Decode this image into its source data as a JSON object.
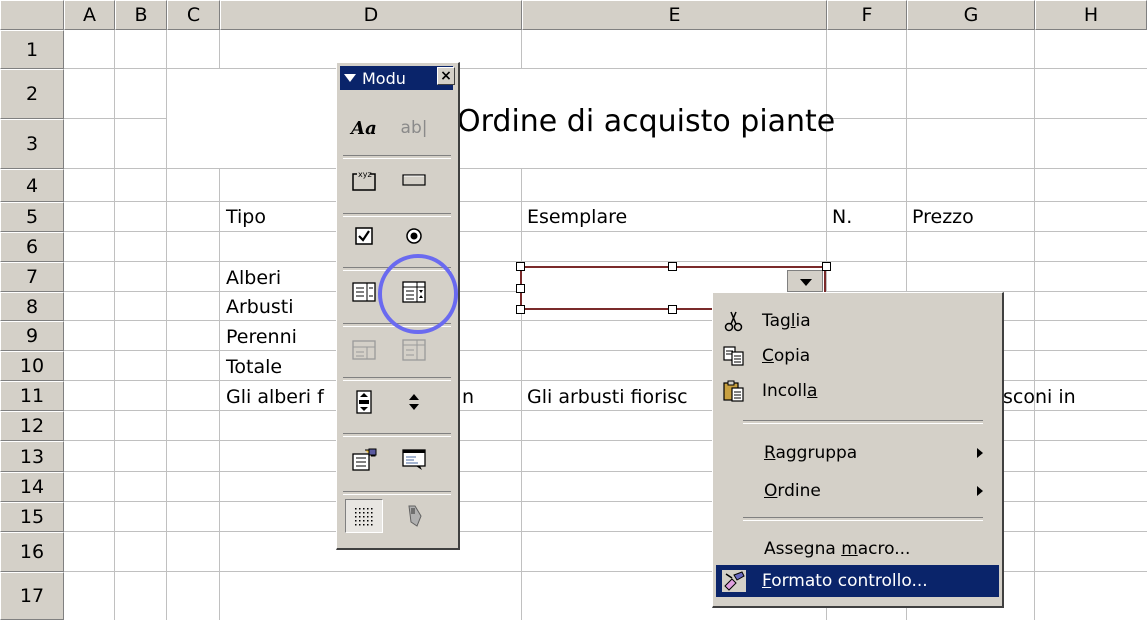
{
  "columns": [
    "A",
    "B",
    "C",
    "D",
    "E",
    "F",
    "G",
    "H"
  ],
  "rows": [
    "1",
    "2",
    "3",
    "4",
    "5",
    "6",
    "7",
    "8",
    "9",
    "10",
    "11",
    "12",
    "13",
    "14",
    "15",
    "16",
    "17"
  ],
  "sheet": {
    "title": "Ordine di acquisto piante",
    "cells": {
      "d5": "Tipo",
      "e5": "Esemplare",
      "f5": "N.",
      "g5": "Prezzo",
      "d7": "Alberi",
      "d8": "Arbusti",
      "d9": "Perenni",
      "d10": "Totale",
      "d11": "Gli alberi f",
      "d11_tail": "n",
      "e11": "Gli arbusti fiorisc",
      "g11": "sconi in"
    }
  },
  "toolbar": {
    "title": "Modu",
    "close": "×",
    "buttons": [
      {
        "icon": "label-icon",
        "glyph": "Aa"
      },
      {
        "icon": "edit-box-icon",
        "glyph": "ab|"
      },
      {
        "icon": "group-box-icon",
        "glyph": "xyz"
      },
      {
        "icon": "button-icon",
        "glyph": ""
      },
      {
        "icon": "checkbox-icon",
        "glyph": "☑"
      },
      {
        "icon": "option-button-icon",
        "glyph": "◉"
      },
      {
        "icon": "list-box-icon",
        "glyph": ""
      },
      {
        "icon": "combo-box-icon",
        "glyph": ""
      },
      {
        "icon": "combo-list-edit-icon",
        "glyph": ""
      },
      {
        "icon": "combo-dropdown-edit-icon",
        "glyph": ""
      },
      {
        "icon": "scroll-bar-icon",
        "glyph": ""
      },
      {
        "icon": "spinner-icon",
        "glyph": "⇕"
      },
      {
        "icon": "control-properties-icon",
        "glyph": ""
      },
      {
        "icon": "edit-code-icon",
        "glyph": ""
      },
      {
        "icon": "toggle-grid-icon",
        "glyph": ""
      },
      {
        "icon": "run-dialog-icon",
        "glyph": ""
      }
    ]
  },
  "context_menu": {
    "items": [
      {
        "label": "Taglia",
        "accel_pre": "Tag",
        "accel": "l",
        "accel_post": "ia",
        "icon": "scissors-icon"
      },
      {
        "label": "Copia",
        "accel_pre": "",
        "accel": "C",
        "accel_post": "opia",
        "icon": "copy-icon"
      },
      {
        "label": "Incolla",
        "accel_pre": "Incoll",
        "accel": "a",
        "accel_post": "",
        "icon": "paste-icon"
      },
      {
        "label": "Raggruppa",
        "accel_pre": "",
        "accel": "R",
        "accel_post": "aggruppa",
        "icon": ""
      },
      {
        "label": "Ordine",
        "accel_pre": "",
        "accel": "O",
        "accel_post": "rdine",
        "icon": ""
      },
      {
        "label": "Assegna macro...",
        "accel_pre": "Assegna ",
        "accel": "m",
        "accel_post": "acro...",
        "icon": ""
      },
      {
        "label": "Formato controllo...",
        "accel_pre": "",
        "accel": "F",
        "accel_post": "ormato controllo...",
        "icon": "format-control-icon"
      }
    ]
  },
  "colors": {
    "selection": "#0a246a",
    "highlight_circle": "#6a6af0",
    "face": "#d4d0c8"
  }
}
